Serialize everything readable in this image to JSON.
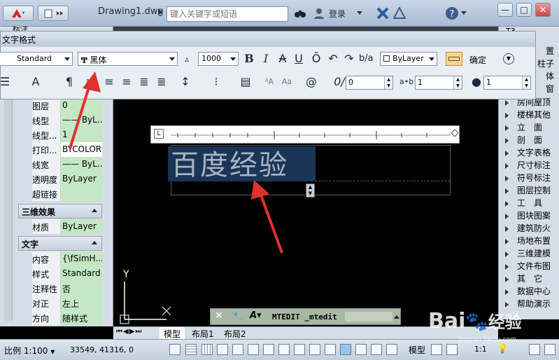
{
  "titlebar": {
    "doc_title": "Drawing1.dwg",
    "search_placeholder": "键入关键字或短语",
    "login_label": "登录",
    "win_minimize": "—",
    "win_maximize": "□",
    "win_close": "✕"
  },
  "left_panel": {
    "header_partial": "标注",
    "rows_general": [
      {
        "key": "图层",
        "value": "0"
      },
      {
        "key": "线型",
        "value": "—— ByL..."
      },
      {
        "key": "线型...",
        "value": "1"
      },
      {
        "key": "打印...",
        "value": "BYCOLOR"
      },
      {
        "key": "线宽",
        "value": "—— ByL..."
      },
      {
        "key": "透明度",
        "value": "ByLayer"
      },
      {
        "key": "超链接",
        "value": ""
      }
    ],
    "section_3d": "三维效果",
    "rows_3d": [
      {
        "key": "材质",
        "value": "ByLayer"
      }
    ],
    "section_text": "文字",
    "rows_text": [
      {
        "key": "内容",
        "value": "{\\fSimH..."
      },
      {
        "key": "样式",
        "value": "Standard"
      },
      {
        "key": "注释性",
        "value": "否"
      },
      {
        "key": "对正",
        "value": "左上"
      },
      {
        "key": "方向",
        "value": "随样式"
      }
    ]
  },
  "text_formatting": {
    "title": "文字格式",
    "style_value": "Standard",
    "font_value": "黑体",
    "height_value": "1000",
    "bold": "B",
    "italic": "I",
    "strike": "A",
    "underline": "U",
    "overline": "Ō",
    "color_value": "ByLayer",
    "ok_label": "确定",
    "oblique_value": "0",
    "tracking_value": "1",
    "width_value": "1"
  },
  "editor": {
    "text": "百度经验"
  },
  "right_panel": {
    "top_partial": "T3",
    "items": [
      "置",
      "柱子",
      "体",
      "窗",
      "房间屋顶",
      "楼梯其他",
      "立　面",
      "剖　面",
      "文字表格",
      "尺寸标注",
      "符号标注",
      "图层控制",
      "工　具",
      "图块图案",
      "建筑防火",
      "场地布置",
      "三维建模",
      "文件布图",
      "其　它",
      "数据中心",
      "帮助演示"
    ]
  },
  "command": {
    "text": "MTEDIT _mtedit"
  },
  "layout_tabs": [
    "模型",
    "布局1",
    "布局2"
  ],
  "statusbar": {
    "scale": "比例 1:100",
    "coords": "33549, 41316, 0",
    "model_label": "模型",
    "anno_scale": "1:1"
  },
  "ucs": {
    "y_label": "Y"
  },
  "watermark": {
    "brand": "Bai",
    "brand2": "经验",
    "url": "jingyan.baidu.com"
  },
  "colors": {
    "accent_red": "#e0322e",
    "panel": "#d5dde6",
    "value_green": "#c4e7c4",
    "highlight": "#1a3556"
  }
}
